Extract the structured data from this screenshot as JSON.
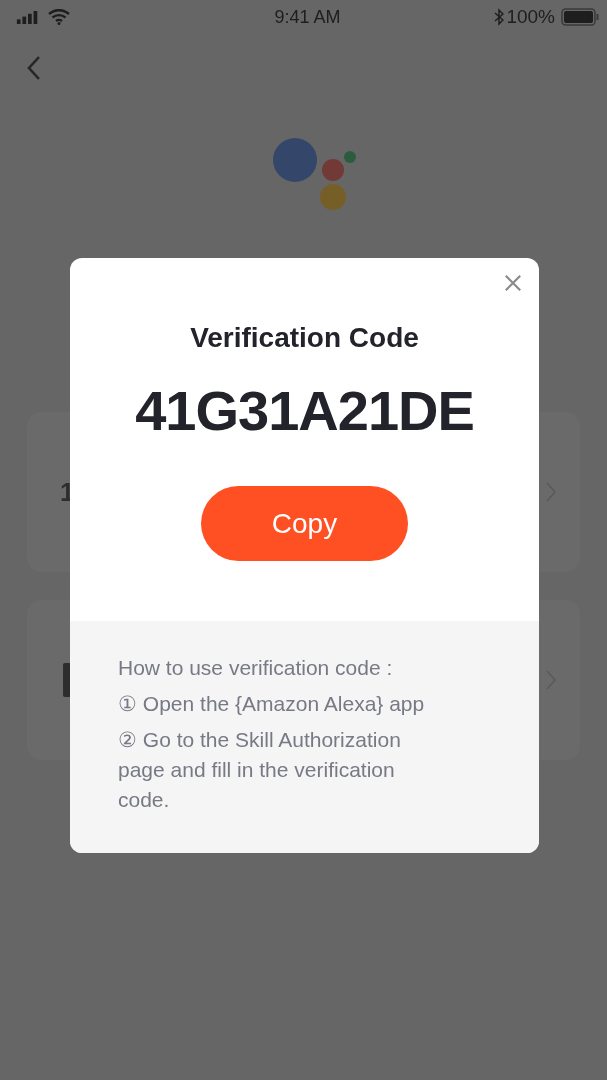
{
  "status_bar": {
    "time": "9:41 AM",
    "battery": "100%"
  },
  "cards": [
    {
      "kind": "text",
      "text": "1"
    },
    {
      "kind": "icon"
    }
  ],
  "dialog": {
    "title": "Verification Code",
    "code": "41G31A21DE",
    "copy_button": "Copy",
    "instructions": {
      "heading": "How to use verification code :",
      "steps": [
        "① Open the {Amazon Alexa} app",
        "② Go to the Skill Authorization page and fill in the verification code."
      ]
    }
  }
}
